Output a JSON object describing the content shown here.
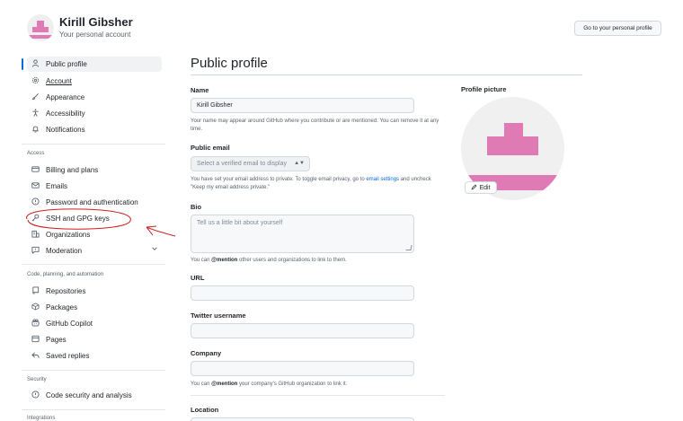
{
  "header": {
    "user_name": "Kirill Gibsher",
    "user_subtitle": "Your personal account",
    "profile_button": "Go to your personal profile"
  },
  "sidebar": {
    "items": [
      {
        "label": "Public profile",
        "icon": "person-icon"
      },
      {
        "label": "Account",
        "icon": "gear-icon"
      },
      {
        "label": "Appearance",
        "icon": "paintbrush-icon"
      },
      {
        "label": "Accessibility",
        "icon": "accessibility-icon"
      },
      {
        "label": "Notifications",
        "icon": "bell-icon"
      }
    ],
    "access_label": "Access",
    "access_items": [
      {
        "label": "Billing and plans",
        "icon": "credit-card-icon"
      },
      {
        "label": "Emails",
        "icon": "mail-icon"
      },
      {
        "label": "Password and authentication",
        "icon": "shield-icon"
      },
      {
        "label": "SSH and GPG keys",
        "icon": "key-icon"
      },
      {
        "label": "Organizations",
        "icon": "organization-icon"
      },
      {
        "label": "Moderation",
        "icon": "report-icon"
      }
    ],
    "code_label": "Code, planning, and automation",
    "code_items": [
      {
        "label": "Repositories",
        "icon": "repo-icon"
      },
      {
        "label": "Packages",
        "icon": "package-icon"
      },
      {
        "label": "GitHub Copilot",
        "icon": "copilot-icon"
      },
      {
        "label": "Pages",
        "icon": "browser-icon"
      },
      {
        "label": "Saved replies",
        "icon": "reply-icon"
      }
    ],
    "security_label": "Security",
    "security_items": [
      {
        "label": "Code security and analysis",
        "icon": "shield-check-icon"
      }
    ],
    "integrations_label": "Integrations"
  },
  "main": {
    "title": "Public profile",
    "name_label": "Name",
    "name_value": "Kirill Gibsher",
    "name_help": "Your name may appear around GitHub where you contribute or are mentioned. You can remove it at any time.",
    "email_label": "Public email",
    "email_select": "Select a verified email to display",
    "email_help_1": "You have set your email address to private. To toggle email privacy, go to ",
    "email_help_link": "email settings",
    "email_help_2": " and uncheck \"Keep my email address private.\"",
    "bio_label": "Bio",
    "bio_placeholder": "Tell us a little bit about yourself",
    "bio_help_1": "You can ",
    "bio_help_mention": "@mention",
    "bio_help_2": " other users and organizations to link to them.",
    "url_label": "URL",
    "twitter_label": "Twitter username",
    "company_label": "Company",
    "company_help_1": "You can ",
    "company_help_mention": "@mention",
    "company_help_2": " your company's GitHub organization to link it.",
    "location_label": "Location"
  },
  "profile_picture": {
    "label": "Profile picture",
    "edit_label": "Edit"
  },
  "colors": {
    "accent": "#0969da",
    "avatar_pink": "#e07ab4",
    "annotation_red": "#cc1f1f"
  }
}
